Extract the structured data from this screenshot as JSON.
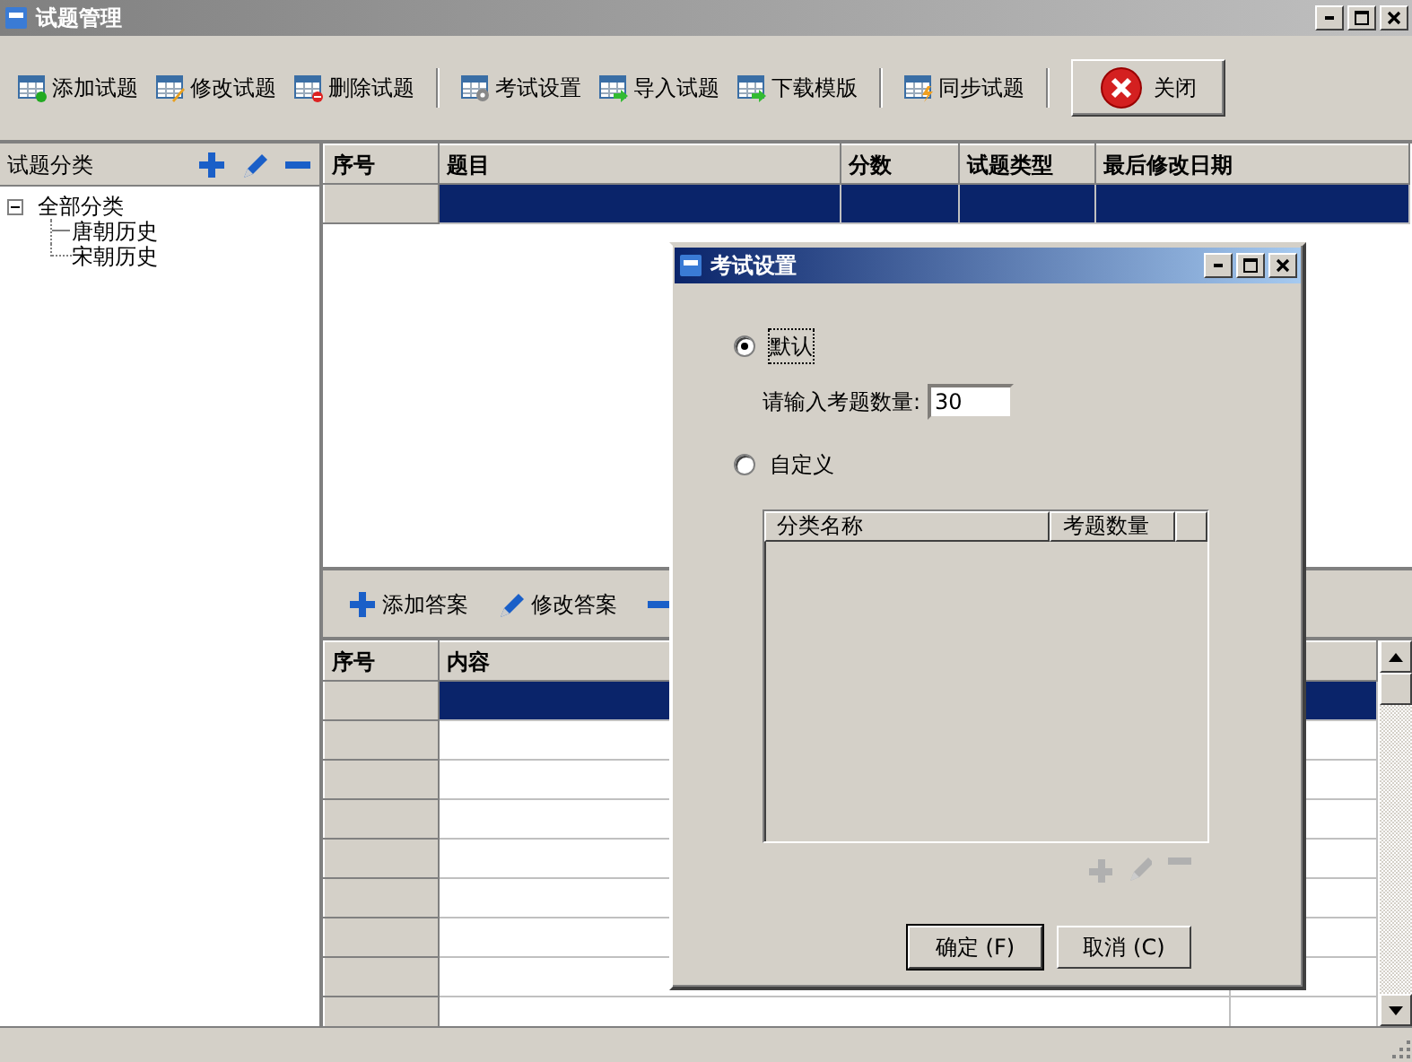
{
  "window": {
    "title": "试题管理"
  },
  "toolbar": [
    {
      "kind": "add",
      "label": "添加试题"
    },
    {
      "kind": "edit",
      "label": "修改试题"
    },
    {
      "kind": "delete",
      "label": "删除试题"
    },
    {
      "kind": "separator"
    },
    {
      "kind": "settings",
      "label": "考试设置"
    },
    {
      "kind": "import",
      "label": "导入试题"
    },
    {
      "kind": "download",
      "label": "下载模版"
    },
    {
      "kind": "separator"
    },
    {
      "kind": "sync",
      "label": "同步试题"
    },
    {
      "kind": "separator"
    },
    {
      "kind": "close",
      "label": "关闭"
    }
  ],
  "category_panel": {
    "title": "试题分类",
    "tree": [
      {
        "label": "全部分类",
        "expanded": true,
        "children": [
          {
            "label": "唐朝历史"
          },
          {
            "label": "宋朝历史"
          }
        ]
      }
    ]
  },
  "question_table": {
    "columns": [
      "序号",
      "题目",
      "分数",
      "试题类型",
      "最后修改日期"
    ],
    "rows": [
      {
        "selected": true
      }
    ]
  },
  "answer_toolbar": [
    {
      "kind": "add",
      "label": "添加答案"
    },
    {
      "kind": "edit",
      "label": "修改答案"
    }
  ],
  "answer_table": {
    "columns": [
      "序号",
      "内容"
    ],
    "rows": [
      {
        "selected": true
      },
      {
        "selected": false
      },
      {
        "selected": false
      },
      {
        "selected": false
      },
      {
        "selected": false
      },
      {
        "selected": false
      },
      {
        "selected": false
      },
      {
        "selected": false
      },
      {
        "selected": false
      }
    ]
  },
  "dialog": {
    "title": "考试设置",
    "options": [
      {
        "label": "默认",
        "selected": true
      },
      {
        "label": "自定义",
        "selected": false
      }
    ],
    "count_label": "请输入考题数量:",
    "count_value": "30",
    "table_columns": [
      "分类名称",
      "考题数量"
    ],
    "table_tools": [
      {
        "kind": "add",
        "disabled": true
      },
      {
        "kind": "edit",
        "disabled": true
      },
      {
        "kind": "remove",
        "disabled": true
      }
    ],
    "buttons": [
      "确定 (F)",
      "取消 (C)"
    ]
  }
}
